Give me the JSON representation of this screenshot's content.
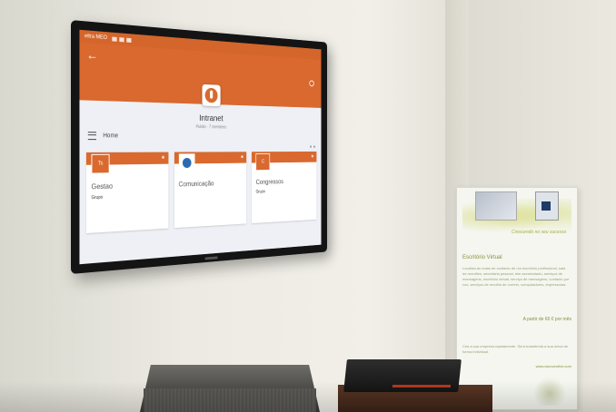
{
  "scene": {
    "description_tags": [
      "wall-mounted-tv",
      "intranet-app",
      "roll-up-banner",
      "speaker",
      "set-top-box"
    ]
  },
  "tv": {
    "status_bar": {
      "carrier": "eltra MEO"
    },
    "app": {
      "title": "Intranet",
      "subtitle": "Publio · 7 members",
      "nav_label": "Home",
      "accent_color": "#d9692e",
      "cards": [
        {
          "avatar_text": "Ts",
          "name": "Gestao",
          "type": "Grupo"
        },
        {
          "avatar_text": "",
          "name": "Comunicação",
          "type": ""
        },
        {
          "avatar_text": "C",
          "name": "Congressos",
          "type": "Grupo"
        }
      ]
    }
  },
  "banner": {
    "tagline": "Crescendo no seu sucesso",
    "heading": "Escritório Virtual",
    "price": "A partir de 60 € por mês",
    "body": "Localiza as notas de contacto de um escritório profissional, sala de reuniões, secretária pessoal, tele-secretariado, serviços de mensagens, escritório virtual, serviço de mensagens, contacto por voz, serviços de recolha de correio, computadores, impressoras.",
    "footer": "Cria a sua empresa rapidamente. Será transferida a sua única de forma individual.",
    "url": "www.oscoveofice.com"
  }
}
